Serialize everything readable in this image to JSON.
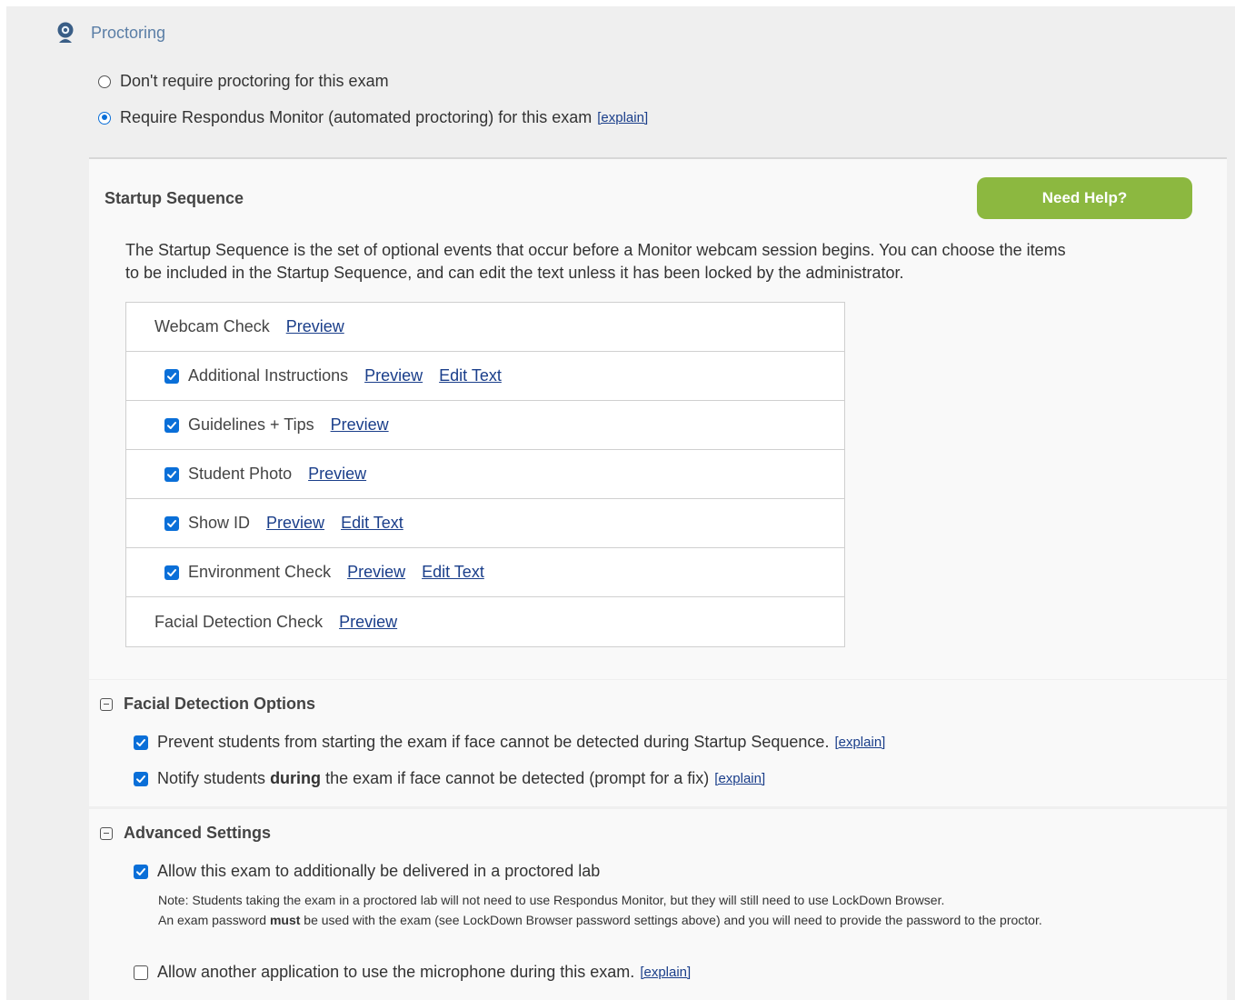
{
  "header": {
    "title": "Proctoring",
    "icon": "webcam-icon"
  },
  "proctoring_options": [
    {
      "label": "Don't require proctoring for this exam",
      "selected": false
    },
    {
      "label": "Require Respondus Monitor (automated proctoring) for this exam",
      "selected": true,
      "link": "[explain]"
    }
  ],
  "startup": {
    "title": "Startup Sequence",
    "help_button": "Need Help?",
    "description": "The Startup Sequence is the set of optional events that occur before a Monitor webcam session begins. You can choose the items to be included in the Startup Sequence, and can edit the text unless it has been locked by the administrator.",
    "items": [
      {
        "label": "Webcam Check",
        "has_checkbox": false,
        "preview": "Preview"
      },
      {
        "label": "Additional Instructions",
        "has_checkbox": true,
        "checked": true,
        "preview": "Preview",
        "edit": "Edit Text"
      },
      {
        "label": "Guidelines + Tips",
        "has_checkbox": true,
        "checked": true,
        "preview": "Preview"
      },
      {
        "label": "Student Photo",
        "has_checkbox": true,
        "checked": true,
        "preview": "Preview"
      },
      {
        "label": "Show ID",
        "has_checkbox": true,
        "checked": true,
        "preview": "Preview",
        "edit": "Edit Text"
      },
      {
        "label": "Environment Check",
        "has_checkbox": true,
        "checked": true,
        "preview": "Preview",
        "edit": "Edit Text"
      },
      {
        "label": "Facial Detection Check",
        "has_checkbox": false,
        "preview": "Preview"
      }
    ]
  },
  "facial": {
    "title": "Facial Detection Options",
    "opt1": {
      "text": "Prevent students from starting the exam if face cannot be detected during Startup Sequence.",
      "link": "[explain]",
      "checked": true
    },
    "opt2": {
      "pre": "Notify students ",
      "bold": "during",
      "post": " the exam if face cannot be detected (prompt for a fix)",
      "link": "[explain]",
      "checked": true
    }
  },
  "advanced": {
    "title": "Advanced Settings",
    "opt1": {
      "text": "Allow this exam to additionally be delivered in a proctored lab",
      "checked": true
    },
    "note_line1": "Note: Students taking the exam in a proctored lab will not need to use Respondus Monitor, but they will still need to use LockDown Browser.",
    "note_line2_pre": "An exam password ",
    "note_line2_bold": "must",
    "note_line2_post": " be used with the exam (see LockDown Browser password settings above) and you will need to provide the password to the proctor.",
    "opt2": {
      "text": "Allow another application to use the microphone during this exam.",
      "link": "[explain]",
      "checked": false
    }
  },
  "colors": {
    "accent": "#0a6fd8",
    "help_button": "#8cb840",
    "link": "#1a3e8a",
    "header_text": "#5a7ea6"
  }
}
